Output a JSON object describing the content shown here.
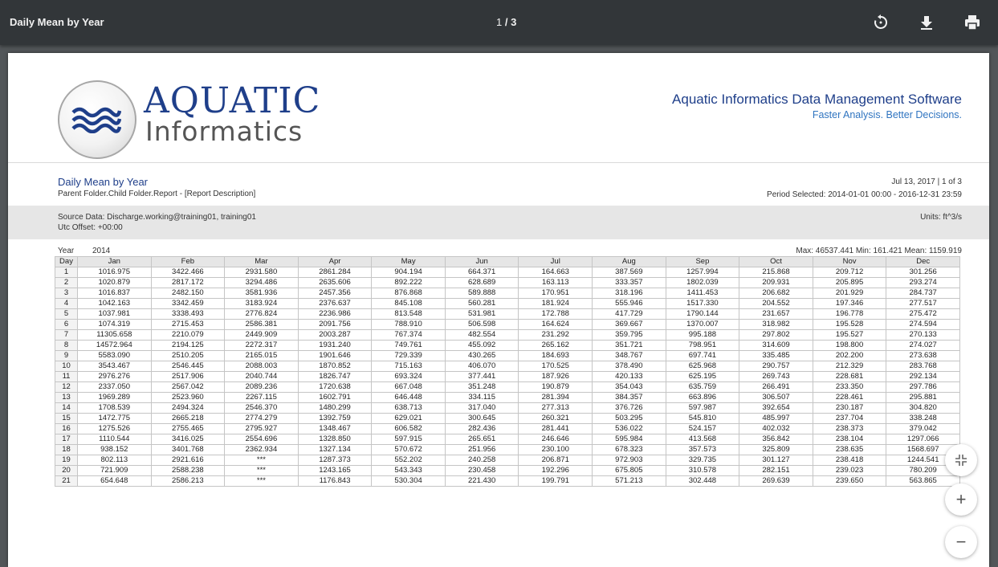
{
  "toolbar": {
    "title": "Daily Mean by Year",
    "page_current": "1",
    "page_total": "/ 3",
    "icons": [
      "rotate-icon",
      "download-icon",
      "print-icon"
    ]
  },
  "logo": {
    "line1": "AQUATIC",
    "line2": "Informatics"
  },
  "company": {
    "name": "Aquatic Informatics Data Management Software",
    "tagline": "Faster Analysis. Better Decisions."
  },
  "report": {
    "title": "Daily Mean by Year",
    "subtitle": "Parent Folder.Child Folder.Report - [Report Description]",
    "date": "Jul 13, 2017 | 1 of 3",
    "period": "Period Selected: 2014-01-01 00:00 - 2016-12-31 23:59",
    "source": "Source Data: Discharge.working@training01, training01",
    "utc": "Utc Offset: +00:00",
    "units": "Units: ft^3/s",
    "year_label": "Year",
    "year_value": "2014",
    "stats": "Max: 46537.441  Min: 161.421  Mean: 1159.919"
  },
  "table": {
    "headers": [
      "Day",
      "Jan",
      "Feb",
      "Mar",
      "Apr",
      "May",
      "Jun",
      "Jul",
      "Aug",
      "Sep",
      "Oct",
      "Nov",
      "Dec"
    ],
    "rows": [
      [
        "1",
        "1016.975",
        "3422.466",
        "2931.580",
        "2861.284",
        "904.194",
        "664.371",
        "164.663",
        "387.569",
        "1257.994",
        "215.868",
        "209.712",
        "301.256"
      ],
      [
        "2",
        "1020.879",
        "2817.172",
        "3294.486",
        "2635.606",
        "892.222",
        "628.689",
        "163.113",
        "333.357",
        "1802.039",
        "209.931",
        "205.895",
        "293.274"
      ],
      [
        "3",
        "1016.837",
        "2482.150",
        "3581.936",
        "2457.356",
        "876.868",
        "589.888",
        "170.951",
        "318.196",
        "1411.453",
        "206.682",
        "201.929",
        "284.737"
      ],
      [
        "4",
        "1042.163",
        "3342.459",
        "3183.924",
        "2376.637",
        "845.108",
        "560.281",
        "181.924",
        "555.946",
        "1517.330",
        "204.552",
        "197.346",
        "277.517"
      ],
      [
        "5",
        "1037.981",
        "3338.493",
        "2776.824",
        "2236.986",
        "813.548",
        "531.981",
        "172.788",
        "417.729",
        "1790.144",
        "231.657",
        "196.778",
        "275.472"
      ],
      [
        "6",
        "1074.319",
        "2715.453",
        "2586.381",
        "2091.756",
        "788.910",
        "506.598",
        "164.624",
        "369.667",
        "1370.007",
        "318.982",
        "195.528",
        "274.594"
      ],
      [
        "7",
        "11305.658",
        "2210.079",
        "2449.909",
        "2003.287",
        "767.374",
        "482.554",
        "231.292",
        "359.795",
        "995.188",
        "297.802",
        "195.527",
        "270.133"
      ],
      [
        "8",
        "14572.964",
        "2194.125",
        "2272.317",
        "1931.240",
        "749.761",
        "455.092",
        "265.162",
        "351.721",
        "798.951",
        "314.609",
        "198.800",
        "274.027"
      ],
      [
        "9",
        "5583.090",
        "2510.205",
        "2165.015",
        "1901.646",
        "729.339",
        "430.265",
        "184.693",
        "348.767",
        "697.741",
        "335.485",
        "202.200",
        "273.638"
      ],
      [
        "10",
        "3543.467",
        "2546.445",
        "2088.003",
        "1870.852",
        "715.163",
        "406.070",
        "170.525",
        "378.490",
        "625.968",
        "290.757",
        "212.329",
        "283.768"
      ],
      [
        "11",
        "2976.276",
        "2517.906",
        "2040.744",
        "1826.747",
        "693.324",
        "377.441",
        "187.926",
        "420.133",
        "625.195",
        "269.743",
        "228.681",
        "292.134"
      ],
      [
        "12",
        "2337.050",
        "2567.042",
        "2089.236",
        "1720.638",
        "667.048",
        "351.248",
        "190.879",
        "354.043",
        "635.759",
        "266.491",
        "233.350",
        "297.786"
      ],
      [
        "13",
        "1969.289",
        "2523.960",
        "2267.115",
        "1602.791",
        "646.448",
        "334.115",
        "281.394",
        "384.357",
        "663.896",
        "306.507",
        "228.461",
        "295.881"
      ],
      [
        "14",
        "1708.539",
        "2494.324",
        "2546.370",
        "1480.299",
        "638.713",
        "317.040",
        "277.313",
        "376.726",
        "597.987",
        "392.654",
        "230.187",
        "304.820"
      ],
      [
        "15",
        "1472.775",
        "2665.218",
        "2774.279",
        "1392.759",
        "629.021",
        "300.645",
        "260.321",
        "503.295",
        "545.810",
        "485.997",
        "237.704",
        "338.248"
      ],
      [
        "16",
        "1275.526",
        "2755.465",
        "2795.927",
        "1348.467",
        "606.582",
        "282.436",
        "281.441",
        "536.022",
        "524.157",
        "402.032",
        "238.373",
        "379.042"
      ],
      [
        "17",
        "1110.544",
        "3416.025",
        "2554.696",
        "1328.850",
        "597.915",
        "265.651",
        "246.646",
        "595.984",
        "413.568",
        "356.842",
        "238.104",
        "1297.066"
      ],
      [
        "18",
        "938.152",
        "3401.768",
        "2362.934",
        "1327.134",
        "570.672",
        "251.956",
        "230.100",
        "678.323",
        "357.573",
        "325.809",
        "238.635",
        "1568.697"
      ],
      [
        "19",
        "802.113",
        "2921.616",
        "***",
        "1287.373",
        "552.202",
        "240.258",
        "206.871",
        "972.903",
        "329.735",
        "301.127",
        "238.418",
        "1244.541"
      ],
      [
        "20",
        "721.909",
        "2588.238",
        "***",
        "1243.165",
        "543.343",
        "230.458",
        "192.296",
        "675.805",
        "310.578",
        "282.151",
        "239.023",
        "780.209"
      ],
      [
        "21",
        "654.648",
        "2586.213",
        "***",
        "1176.843",
        "530.304",
        "221.430",
        "199.791",
        "571.213",
        "302.448",
        "269.639",
        "239.650",
        "563.865"
      ]
    ]
  },
  "fab": {
    "zoom_in": "+",
    "zoom_out": "−"
  }
}
